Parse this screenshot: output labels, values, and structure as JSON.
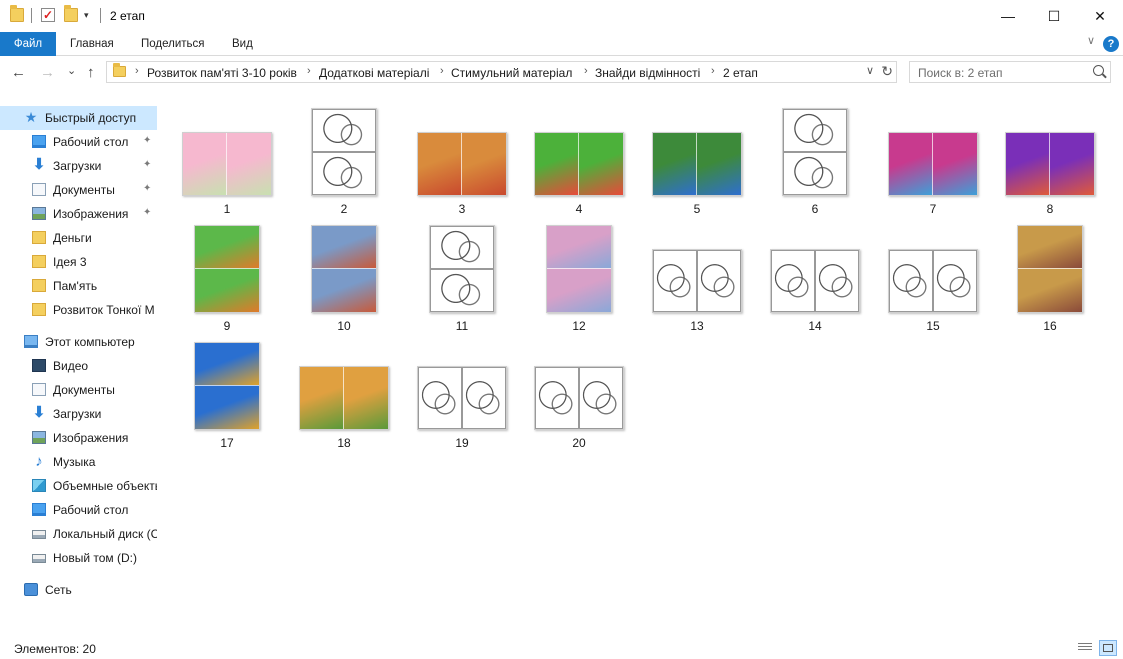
{
  "window": {
    "title": "2 етап",
    "minimize_glyph": "—",
    "maximize_glyph": "☐",
    "close_glyph": "✕"
  },
  "ribbon": {
    "tabs": [
      "Файл",
      "Главная",
      "Поделиться",
      "Вид"
    ],
    "help_glyph": "?",
    "collapse_glyph": "∨"
  },
  "nav": {
    "back_glyph": "←",
    "forward_glyph": "→",
    "recent_glyph": "⌄",
    "up_glyph": "↑",
    "breadcrumbs": [
      "Розвиток пам'яті 3-10 років",
      "Додаткові матеріалі",
      "Стимульний матеріал",
      "Знайди відмінності",
      "2 етап"
    ],
    "crumb_sep": "›",
    "dropdown_glyph": "∨",
    "refresh_glyph": "↻"
  },
  "search": {
    "placeholder": "Поиск в: 2 етап"
  },
  "sidebar": {
    "items": [
      {
        "label": "Быстрый доступ",
        "icon": "star-icon",
        "pinned": false
      },
      {
        "label": "Рабочий стол",
        "icon": "desktop-icon",
        "pinned": true
      },
      {
        "label": "Загрузки",
        "icon": "downloads-icon",
        "pinned": true
      },
      {
        "label": "Документы",
        "icon": "documents-icon",
        "pinned": true
      },
      {
        "label": "Изображения",
        "icon": "pictures-icon",
        "pinned": true
      },
      {
        "label": "Деньги",
        "icon": "folder-icon",
        "pinned": false
      },
      {
        "label": "Ідея 3",
        "icon": "folder-icon",
        "pinned": false
      },
      {
        "label": "Пам'ять",
        "icon": "folder-icon",
        "pinned": false
      },
      {
        "label": "Розвиток Тонкої М",
        "icon": "folder-icon",
        "pinned": false
      },
      {
        "label": "Этот компьютер",
        "icon": "computer-icon",
        "pinned": false
      },
      {
        "label": "Видео",
        "icon": "video-icon",
        "pinned": false
      },
      {
        "label": "Документы",
        "icon": "documents-icon",
        "pinned": false
      },
      {
        "label": "Загрузки",
        "icon": "downloads-icon",
        "pinned": false
      },
      {
        "label": "Изображения",
        "icon": "pictures-icon",
        "pinned": false
      },
      {
        "label": "Музыка",
        "icon": "music-icon",
        "pinned": false
      },
      {
        "label": "Объемные объекты",
        "icon": "3d-objects-icon",
        "pinned": false
      },
      {
        "label": "Рабочий стол",
        "icon": "desktop-icon",
        "pinned": false
      },
      {
        "label": "Локальный диск (C",
        "icon": "local-disk-icon",
        "pinned": false
      },
      {
        "label": "Новый том (D:)",
        "icon": "disk-icon",
        "pinned": false
      },
      {
        "label": "Сеть",
        "icon": "network-icon",
        "pinned": false
      }
    ],
    "pin_glyph": "📌"
  },
  "files": [
    {
      "name": "1",
      "layout": "horizontal",
      "colors": [
        "#f6b8cf",
        "#c8e0b0"
      ]
    },
    {
      "name": "2",
      "layout": "vertical",
      "colors": [
        "#ffffff",
        "#ffffff"
      ]
    },
    {
      "name": "3",
      "layout": "horizontal",
      "colors": [
        "#d98b3c",
        "#c9492e"
      ]
    },
    {
      "name": "4",
      "layout": "horizontal",
      "colors": [
        "#4cb13a",
        "#e84a3a"
      ]
    },
    {
      "name": "5",
      "layout": "horizontal",
      "colors": [
        "#3d8a3a",
        "#2f6fcf"
      ]
    },
    {
      "name": "6",
      "layout": "vertical",
      "colors": [
        "#f4f4f4",
        "#f4f4f4"
      ]
    },
    {
      "name": "7",
      "layout": "horizontal",
      "colors": [
        "#c83a8e",
        "#3ea0d8"
      ]
    },
    {
      "name": "8",
      "layout": "horizontal",
      "colors": [
        "#7a2fb8",
        "#e05a3a"
      ]
    },
    {
      "name": "9",
      "layout": "vertical",
      "colors": [
        "#5cb84a",
        "#e07a2a"
      ]
    },
    {
      "name": "10",
      "layout": "vertical",
      "colors": [
        "#7a9ac8",
        "#c85a3a"
      ]
    },
    {
      "name": "11",
      "layout": "vertical",
      "colors": [
        "#ffffff",
        "#ffffff"
      ]
    },
    {
      "name": "12",
      "layout": "vertical",
      "colors": [
        "#d8a0c8",
        "#8aa8d8"
      ]
    },
    {
      "name": "13",
      "layout": "horizontal",
      "colors": [
        "#ffffff",
        "#ffffff"
      ]
    },
    {
      "name": "14",
      "layout": "horizontal",
      "colors": [
        "#ffffff",
        "#ffffff"
      ]
    },
    {
      "name": "15",
      "layout": "horizontal",
      "colors": [
        "#ffffff",
        "#ffffff"
      ]
    },
    {
      "name": "16",
      "layout": "vertical",
      "colors": [
        "#c89a4a",
        "#8a4a3a"
      ]
    },
    {
      "name": "17",
      "layout": "vertical",
      "colors": [
        "#2a6fd0",
        "#e0a22a"
      ]
    },
    {
      "name": "18",
      "layout": "horizontal",
      "colors": [
        "#e0a040",
        "#5a9a3a"
      ]
    },
    {
      "name": "19",
      "layout": "horizontal",
      "colors": [
        "#f6f6f6",
        "#f6f6f6"
      ]
    },
    {
      "name": "20",
      "layout": "horizontal",
      "colors": [
        "#ffffff",
        "#ffffff"
      ]
    }
  ],
  "status": {
    "item_count": "Элементов: 20"
  },
  "colors": {
    "accent": "#1979ca",
    "selection": "#cce8ff"
  }
}
